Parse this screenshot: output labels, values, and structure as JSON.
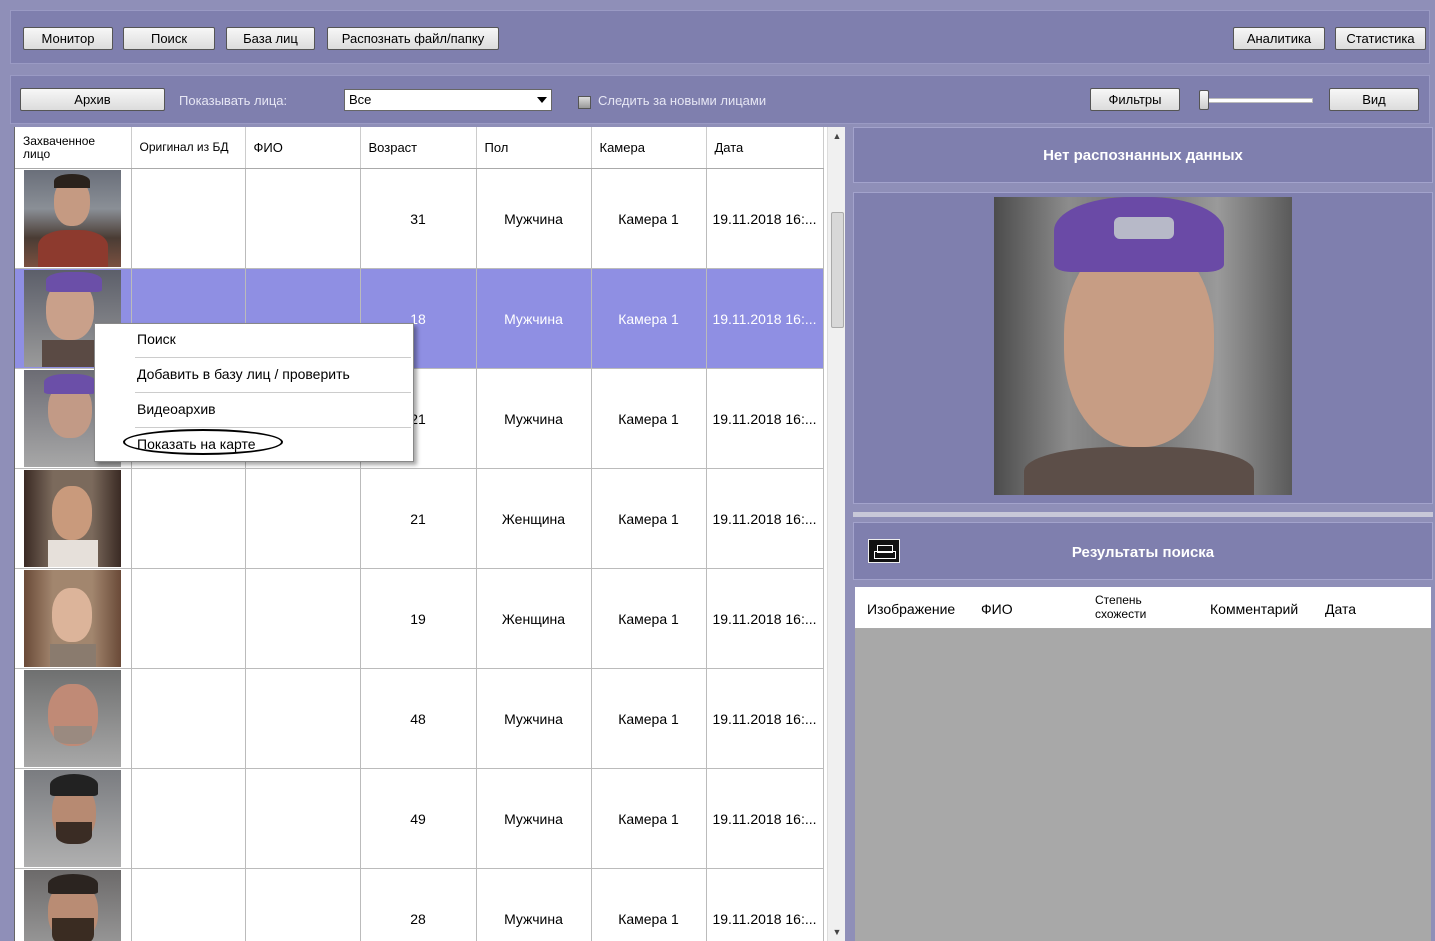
{
  "toolbar": {
    "monitor": "Монитор",
    "search": "Поиск",
    "face_db": "База лиц",
    "recognize": "Распознать файл/папку",
    "analytics": "Аналитика",
    "statistics": "Статистика"
  },
  "filterbar": {
    "archive": "Архив",
    "show_faces_label": "Показывать лица:",
    "show_faces_value": "Все",
    "follow_new": "Следить за новыми лицами",
    "filters": "Фильтры",
    "view": "Вид"
  },
  "table": {
    "columns": [
      "Захваченное лицо",
      "Оригинал из БД",
      "ФИО",
      "Возраст",
      "Пол",
      "Камера",
      "Дата"
    ],
    "rows": [
      {
        "age": "31",
        "gender": "Мужчина",
        "camera": "Камера 1",
        "date": "19.11.2018 16:..."
      },
      {
        "age": "18",
        "gender": "Мужчина",
        "camera": "Камера 1",
        "date": "19.11.2018 16:..."
      },
      {
        "age": "21",
        "gender": "Мужчина",
        "camera": "Камера 1",
        "date": "19.11.2018 16:..."
      },
      {
        "age": "21",
        "gender": "Женщина",
        "camera": "Камера 1",
        "date": "19.11.2018 16:..."
      },
      {
        "age": "19",
        "gender": "Женщина",
        "camera": "Камера 1",
        "date": "19.11.2018 16:..."
      },
      {
        "age": "48",
        "gender": "Мужчина",
        "camera": "Камера 1",
        "date": "19.11.2018 16:..."
      },
      {
        "age": "49",
        "gender": "Мужчина",
        "camera": "Камера 1",
        "date": "19.11.2018 16:..."
      },
      {
        "age": "28",
        "gender": "Мужчина",
        "camera": "Камера 1",
        "date": "19.11.2018 16:..."
      }
    ]
  },
  "context_menu": {
    "items": [
      "Поиск",
      "Добавить в базу лиц / проверить",
      "Видеоархив",
      "Показать на карте"
    ]
  },
  "right": {
    "no_data_title": "Нет распознанных данных",
    "results_title": "Результаты поиска",
    "results_columns": [
      "Изображение",
      "ФИО",
      "Степень схожести",
      "Комментарий",
      "Дата"
    ]
  },
  "colors": {
    "background": "#8f8fb8",
    "panel": "#7f7fae",
    "selection": "#8f8fe3"
  }
}
